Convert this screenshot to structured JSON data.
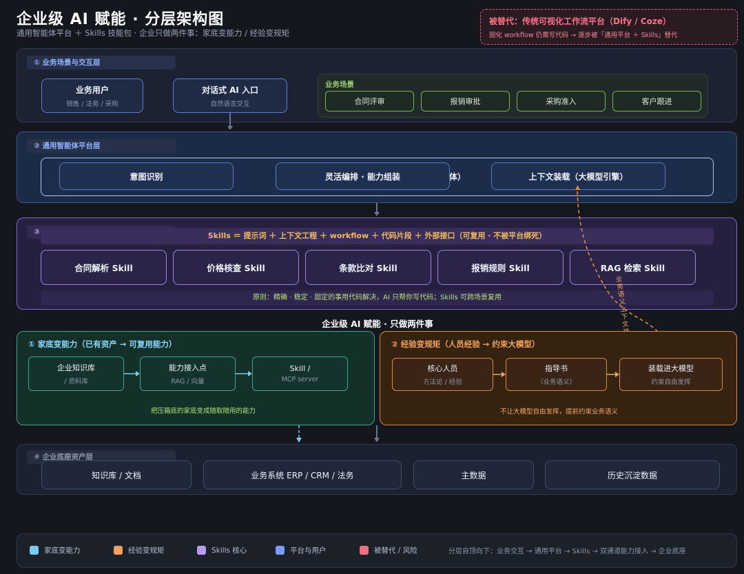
{
  "header": {
    "title": "企业级 AI 赋能 · 分层架构图",
    "subtitle": "通用智能体平台 ＋ Skills 技能包 · 企业只做两件事：家底变能力 / 经验变规矩"
  },
  "replaced": {
    "title": "被替代：传统可视化工作流平台（Dify / Coze）",
    "desc": "固化 workflow 仍需写代码 → 逐步被「通用平台 ＋ Skills」替代"
  },
  "layer1": {
    "tag": "① 业务场景与交互层",
    "user_title": "业务用户",
    "user_sub": "销售 / 法务 / 采购",
    "entry_title": "对话式 AI 入口",
    "entry_sub": "自然语言交互",
    "scenes_label": "业务场景",
    "scenes": [
      "合同评审",
      "报销审批",
      "采购准入",
      "客户跟进"
    ]
  },
  "layer2": {
    "tag": "② 通用智能体平台层",
    "hidden_suffix": "体）",
    "boxes": [
      "意图识别",
      "灵活编排 · 能力组装",
      "上下文装载（大模型引擎）"
    ]
  },
  "layer3": {
    "tag": "③",
    "formula": "Skills ＝ 提示词 ＋ 上下文工程 ＋ workflow ＋ 代码片段 ＋ 外部接口（可复用 · 不被平台绑死）",
    "skills": [
      "合同解析 Skill",
      "价格核查 Skill",
      "条款比对 Skill",
      "报销规则 Skill",
      "RAG 检索 Skill"
    ],
    "principle": "原则：精确 · 稳定 · 固定的事用代码解决，AI 只帮你写代码；Skills 可跨场景复用",
    "vertical_note": "业务语义上下文装载"
  },
  "middle_title": "企业级 AI 赋能 · 只做两件事",
  "panel_left": {
    "title": "① 家底变能力（已有资产 → 可复用能力）",
    "boxes": [
      {
        "t": "企业知识库",
        "s": "/ 资料库"
      },
      {
        "t": "能力接入点",
        "s": "RAG / 向量"
      },
      {
        "t": "Skill /",
        "s": "MCP server"
      }
    ],
    "note": "把压箱底的家底变成随取随用的能力"
  },
  "panel_right": {
    "title": "② 经验变规矩（人员经验 → 约束大模型）",
    "boxes": [
      {
        "t": "核心人员",
        "s": "方法论 / 经验"
      },
      {
        "t": "指导书",
        "s": "（业务语义）"
      },
      {
        "t": "装载进大模型",
        "s": "约束自由发挥"
      }
    ],
    "note": "不让大模型自由发挥，提前约束业务语义"
  },
  "layer4": {
    "tag": "④ 企业底座资产层",
    "boxes": [
      "知识库 / 文档",
      "业务系统 ERP / CRM / 法务",
      "主数据",
      "历史沉淀数据"
    ]
  },
  "legend": {
    "items": [
      {
        "label": "家底变能力",
        "color": "#7cc8f0"
      },
      {
        "label": "经验变规矩",
        "color": "#f2a060"
      },
      {
        "label": "Skills 核心",
        "color": "#b99cf0"
      },
      {
        "label": "平台与用户",
        "color": "#7b9cf0"
      },
      {
        "label": "被替代 / 风险",
        "color": "#f07080"
      }
    ],
    "flow": "分层自顶向下：业务交互 → 通用平台 → Skills → 双通道能力接入 → 企业底座"
  },
  "colors": {
    "teal": "#3fa58e",
    "orange": "#e08a3e",
    "purple": "#9d85e0",
    "blue": "#5c7fd6",
    "red": "#e0637a"
  }
}
